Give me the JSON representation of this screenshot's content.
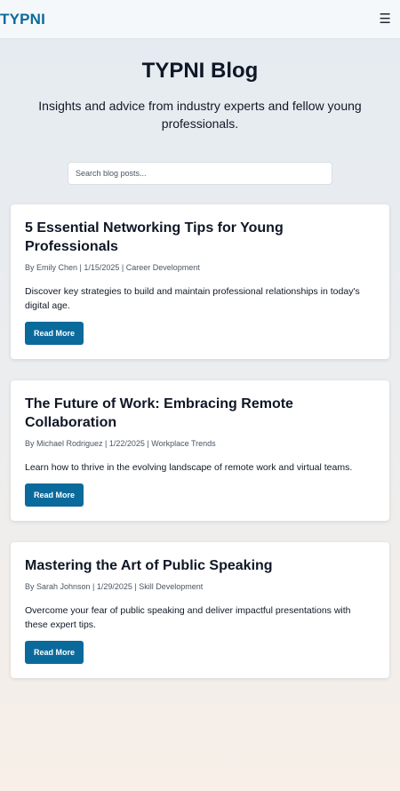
{
  "nav": {
    "logo": "TYPNI",
    "menu_icon": "☰"
  },
  "hero": {
    "title": "TYPNI Blog",
    "subtitle": "Insights and advice from industry experts and fellow young professionals."
  },
  "search": {
    "placeholder": "Search blog posts..."
  },
  "posts": [
    {
      "title": "5 Essential Networking Tips for Young Professionals",
      "meta": "By Emily Chen | 1/15/2025 | Career Development",
      "excerpt": "Discover key strategies to build and maintain professional relationships in today's digital age.",
      "button": "Read More"
    },
    {
      "title": "The Future of Work: Embracing Remote Collaboration",
      "meta": "By Michael Rodriguez | 1/22/2025 | Workplace Trends",
      "excerpt": "Learn how to thrive in the evolving landscape of remote work and virtual teams.",
      "button": "Read More"
    },
    {
      "title": "Mastering the Art of Public Speaking",
      "meta": "By Sarah Johnson | 1/29/2025 | Skill Development",
      "excerpt": "Overcome your fear of public speaking and deliver impactful presentations with these expert tips.",
      "button": "Read More"
    }
  ],
  "colors": {
    "brand": "#0b6a9c",
    "text": "#0f1726"
  }
}
